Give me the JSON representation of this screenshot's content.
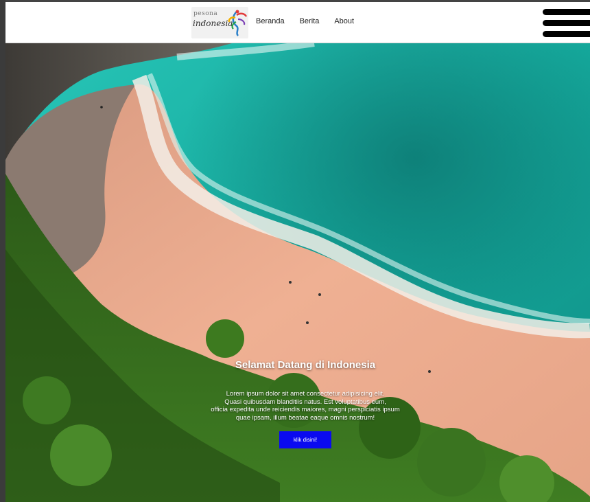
{
  "logo": {
    "line1": "pesona",
    "line2": "indonesia"
  },
  "nav": {
    "items": [
      {
        "label": "Beranda"
      },
      {
        "label": "Berita"
      },
      {
        "label": "About"
      }
    ],
    "menu_icon": "hamburger-menu-icon"
  },
  "hero": {
    "title": "Selamat Datang di Indonesia",
    "description_lines": [
      "Lorem ipsum dolor sit amet consectetur adipisicing elit.",
      "Quasi quibusdam blanditiis natus. Est voluptatibus eum,",
      "officia expedita unde reiciendis maiores, magni perspiciatis ipsum",
      "quae ipsam, illum beatae eaque omnis nostrum!"
    ],
    "button_label": "klik disini!"
  },
  "colors": {
    "navbar_bg": "#ffffff",
    "button_bg": "#0a0af0",
    "sea": "#1fb8aa",
    "sand": "#e9a58a",
    "forest": "#2f6f1f"
  }
}
